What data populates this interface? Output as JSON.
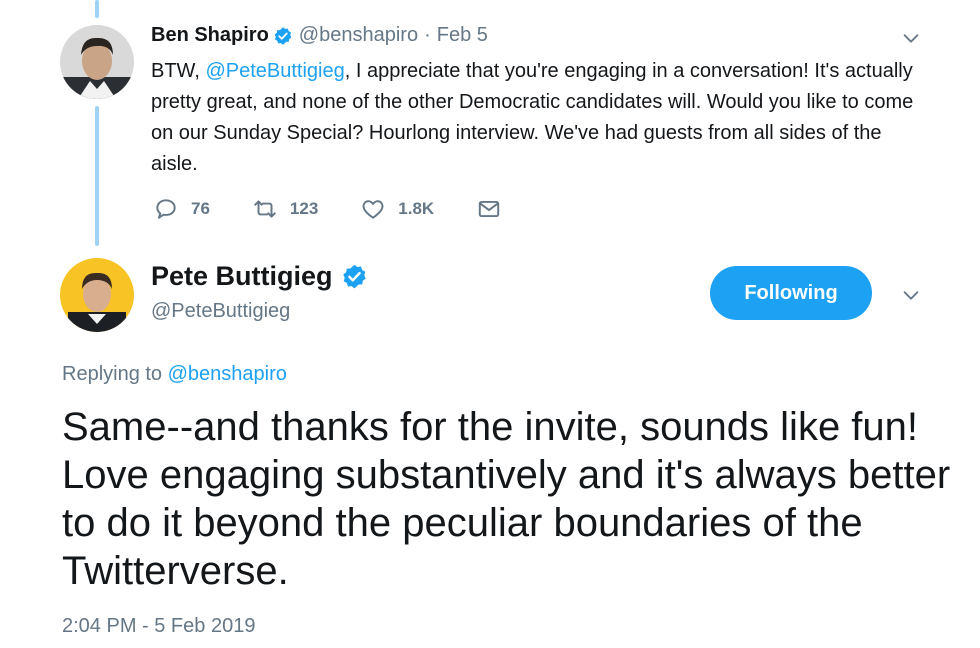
{
  "parent_tweet": {
    "author_name": "Ben Shapiro",
    "handle": "@benshapiro",
    "separator": "·",
    "date": "Feb 5",
    "text_before": "BTW, ",
    "mention": "@PeteButtigieg",
    "text_after": ", I appreciate that you're engaging in a conversation! It's actually pretty great, and none of the other Democratic candidates will. Would you like to come on our Sunday Special? Hourlong interview. We've had guests from all sides of the aisle.",
    "replies": "76",
    "retweets": "123",
    "likes": "1.8K"
  },
  "reply_tweet": {
    "author_name": "Pete Buttigieg",
    "handle": "@PeteButtigieg",
    "follow_label": "Following",
    "replying_prefix": "Replying to ",
    "replying_to": "@benshapiro",
    "text": "Same--and thanks for the invite, sounds like fun! Love engaging substantively and it's always better to do it beyond the peculiar boundaries of the Twitterverse.",
    "timestamp": "2:04 PM - 5 Feb 2019"
  },
  "icons": {
    "verified": "verified-badge-icon",
    "reply": "reply-bubble-icon",
    "retweet": "retweet-icon",
    "like": "heart-icon",
    "dm": "envelope-icon",
    "menu": "chevron-down-icon"
  },
  "colors": {
    "accent": "#1da1f2",
    "muted": "#657786",
    "text": "#14171a",
    "thread_line": "#9ed2f6"
  }
}
